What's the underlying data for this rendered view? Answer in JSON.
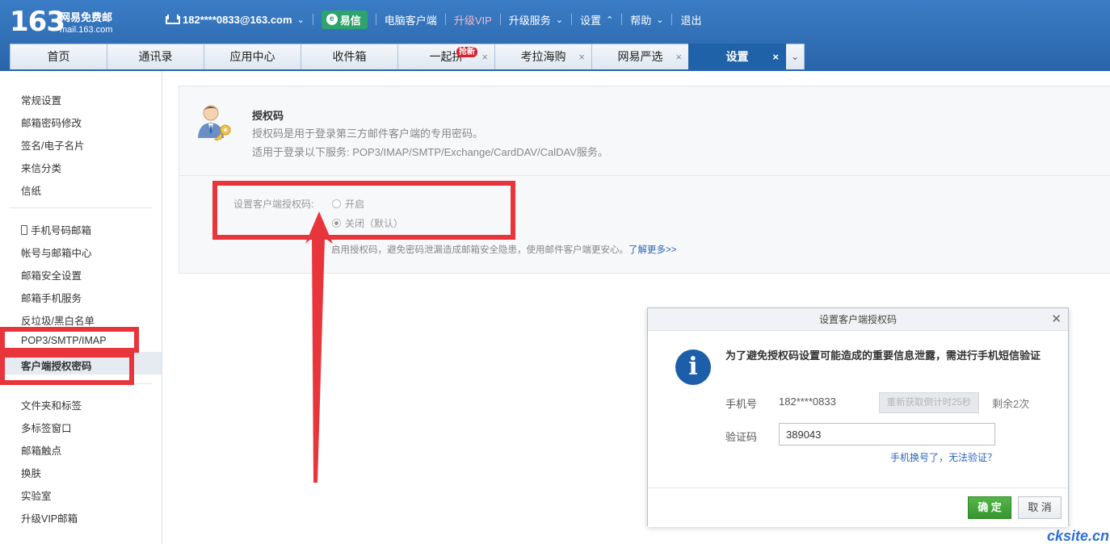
{
  "header": {
    "logo_number": "163",
    "logo_cn": "网易免费邮",
    "logo_en": "mail.163.com",
    "account": "182****0833@163.com",
    "yixin": "易信",
    "client": "电脑客户端",
    "upgrade_vip": "升级VIP",
    "upgrade_service": "升级服务",
    "settings": "设置",
    "help": "帮助",
    "logout": "退出"
  },
  "tabs": [
    {
      "label": "首页"
    },
    {
      "label": "通讯录"
    },
    {
      "label": "应用中心"
    },
    {
      "label": "收件箱"
    },
    {
      "label": "一起拼",
      "badge": "抢新"
    },
    {
      "label": "考拉海购"
    },
    {
      "label": "网易严选"
    },
    {
      "label": "设置"
    }
  ],
  "sidebar": {
    "group1": [
      "常规设置",
      "邮箱密码修改",
      "签名/电子名片",
      "来信分类",
      "信纸"
    ],
    "group2": [
      "手机号码邮箱",
      "帐号与邮箱中心",
      "邮箱安全设置",
      "邮箱手机服务",
      "反垃圾/黑白名单",
      "POP3/SMTP/IMAP",
      "客户端授权密码"
    ],
    "group3": [
      "文件夹和标签",
      "多标签窗口",
      "邮箱触点",
      "换肤",
      "实验室",
      "升级VIP邮箱"
    ]
  },
  "panel": {
    "title": "授权码",
    "desc1": "授权码是用于登录第三方邮件客户端的专用密码。",
    "desc2": "适用于登录以下服务: POP3/IMAP/SMTP/Exchange/CardDAV/CalDAV服务。",
    "option_label": "设置客户端授权码:",
    "option_on": "开启",
    "option_off": "关闭（默认）",
    "hint": "启用授权码，避免密码泄漏造成邮箱安全隐患，使用邮件客户端更安心。",
    "hint_link": "了解更多>>"
  },
  "dialog": {
    "title": "设置客户端授权码",
    "message": "为了避免授权码设置可能造成的重要信息泄露，需进行手机短信验证",
    "phone_label": "手机号",
    "phone_value": "182****0833",
    "resend": "重新获取倒计时25秒",
    "remaining": "剩余2次",
    "code_label": "验证码",
    "code_value": "389043",
    "change_link": "手机换号了，无法验证？",
    "ok": "确 定",
    "cancel": "取 消"
  },
  "watermark": "cksite.cn",
  "colors": {
    "header": "#2a64a8",
    "annotation": "#e8353c",
    "ok_button": "#37952e"
  }
}
